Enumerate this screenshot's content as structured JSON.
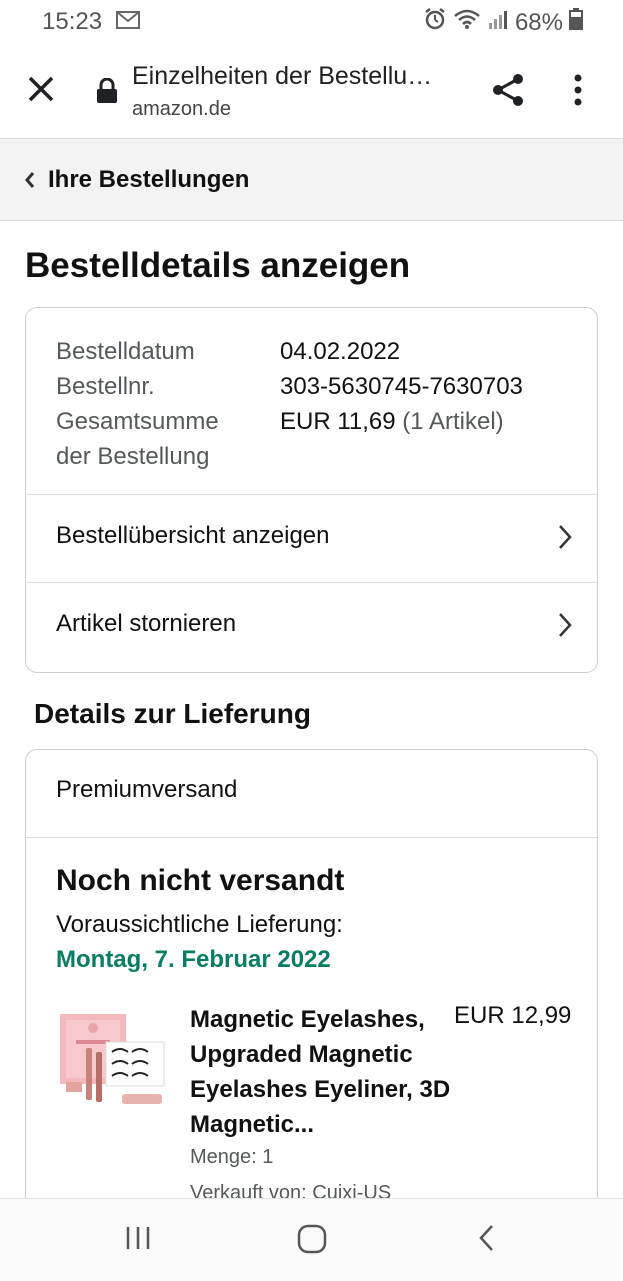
{
  "status_bar": {
    "time": "15:23",
    "battery": "68%"
  },
  "browser": {
    "title": "Einzelheiten der Bestellu…",
    "domain": "amazon.de"
  },
  "back_link": {
    "label": "Ihre Bestellungen"
  },
  "page_title": "Bestelldetails anzeigen",
  "order_summary": {
    "date_label": "Bestelldatum",
    "date_value": "04.02.2022",
    "number_label": "Bestellnr.",
    "number_value": "303-5630745-7630703",
    "total_label_line1": "Gesamtsumme",
    "total_label_line2": "der Bestellung",
    "total_value": "EUR 11,69",
    "total_items": "(1 Artikel)"
  },
  "actions": {
    "view_overview": "Bestellübersicht anzeigen",
    "cancel_items": "Artikel stornieren"
  },
  "delivery": {
    "section_title": "Details zur Lieferung",
    "shipping_method": "Premiumversand",
    "status": "Noch nicht versandt",
    "estimate_label": "Voraussichtliche Lieferung:",
    "estimate_date": "Montag, 7. Februar 2022"
  },
  "product": {
    "name": "Magnetic Eyelashes, Upgraded Magnetic Eyelashes Eyeliner, 3D Magnetic...",
    "price": "EUR 12,99",
    "quantity": "Menge: 1",
    "seller": "Verkauft von: Cuixi-US"
  },
  "colors": {
    "delivery_green": "#067D62"
  }
}
